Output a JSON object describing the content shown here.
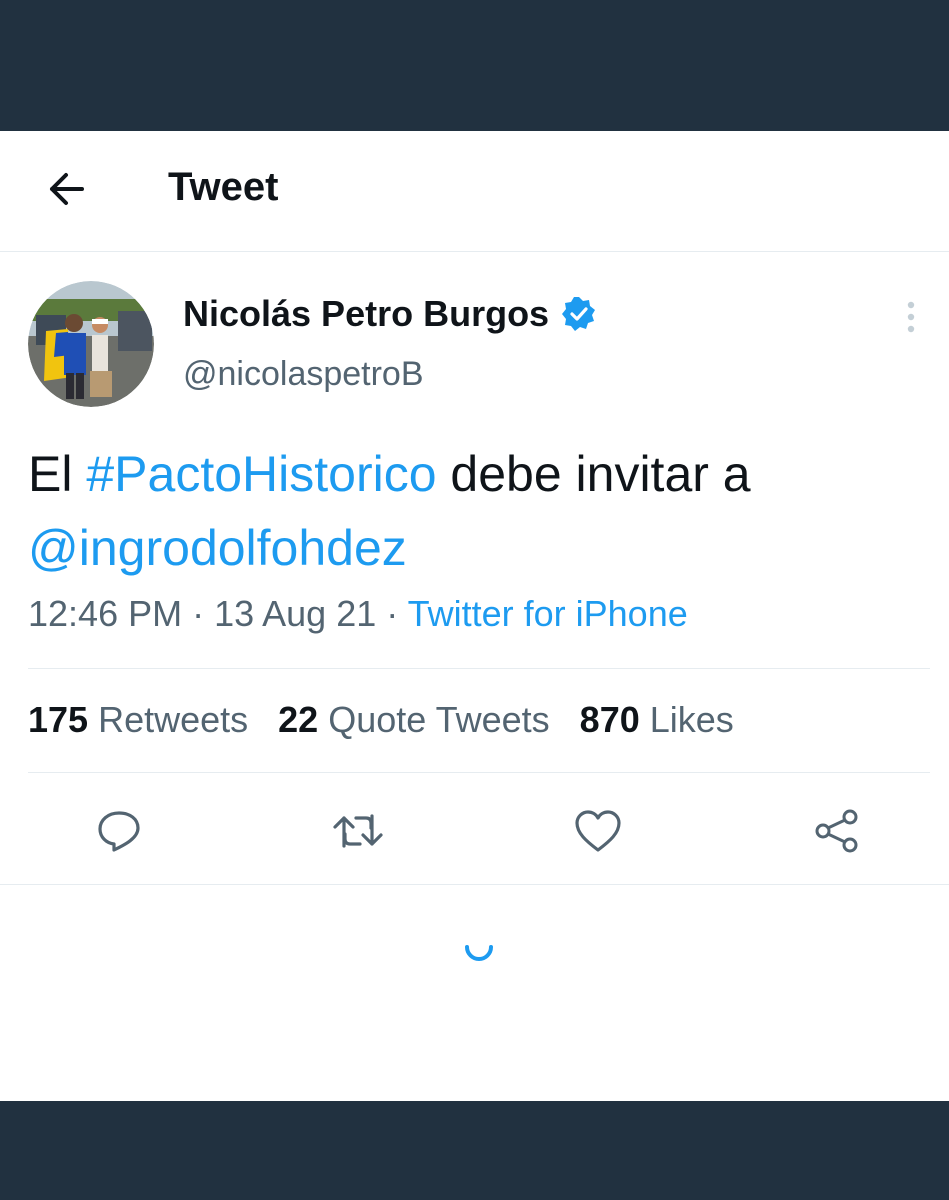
{
  "colors": {
    "frame": "#213140",
    "accent": "#1d9bf0",
    "text_primary": "#0f1419",
    "text_secondary": "#536471"
  },
  "header": {
    "title": "Tweet",
    "back_icon": "arrow-left-icon"
  },
  "tweet": {
    "author": {
      "display_name": "Nicolás Petro Burgos",
      "handle": "@nicolaspetroB",
      "verified_icon": "verified-badge-icon"
    },
    "text": {
      "prefix": "El ",
      "hashtag": "#PactoHistorico",
      "middle": " debe invitar a ",
      "mention": "@ingrodolfohdez"
    },
    "meta": {
      "time": "12:46 PM",
      "separator": " · ",
      "date": "13 Aug 21",
      "source": "Twitter for iPhone"
    },
    "stats": {
      "retweets_count": "175",
      "retweets_label": "Retweets",
      "quotes_count": "22",
      "quotes_label": "Quote Tweets",
      "likes_count": "870",
      "likes_label": "Likes"
    },
    "actions": [
      "reply-icon",
      "retweet-icon",
      "like-icon",
      "share-icon"
    ]
  }
}
